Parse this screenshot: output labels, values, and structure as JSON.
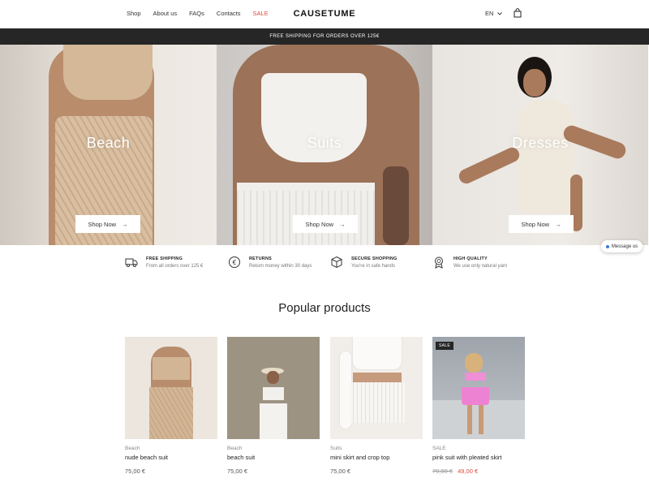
{
  "header": {
    "nav": [
      {
        "label": "Shop"
      },
      {
        "label": "About us"
      },
      {
        "label": "FAQs"
      },
      {
        "label": "Contacts"
      },
      {
        "label": "SALE"
      }
    ],
    "logo": "CAUSETUME",
    "language": "EN",
    "cart_icon": "bag-icon"
  },
  "promo": {
    "text": "FREE SHIPPING FOR ORDERS OVER 125€"
  },
  "hero": {
    "panels": [
      {
        "title": "Beach",
        "button": "Shop Now"
      },
      {
        "title": "Suits",
        "button": "Shop Now"
      },
      {
        "title": "Dresses",
        "button": "Shop Now"
      }
    ]
  },
  "chat": {
    "label": "Message us"
  },
  "features": [
    {
      "icon": "truck-icon",
      "title": "FREE SHIPPING",
      "subtitle": "From all orders over 125 €"
    },
    {
      "icon": "euro-coin-icon",
      "title": "RETURNS",
      "subtitle": "Return money within 30 days"
    },
    {
      "icon": "box-icon",
      "title": "SECURE SHOPPING",
      "subtitle": "You're in safe hands"
    },
    {
      "icon": "quality-badge-icon",
      "title": "HIGH QUALITY",
      "subtitle": "We use only natural yarn"
    }
  ],
  "products_section": {
    "title": "Popular products",
    "items": [
      {
        "category": "Beach",
        "name": "nude beach suit",
        "price": "75,00 €"
      },
      {
        "category": "Beach",
        "name": "beach suit",
        "price": "75,00 €"
      },
      {
        "category": "Suits",
        "name": "mini skirt and crop top",
        "price": "75,00 €"
      },
      {
        "category": "SALE",
        "name": "pink suit with pleated skirt",
        "old_price": "70,00 €",
        "price": "49,00 €",
        "badge": "SALE"
      }
    ]
  },
  "colors": {
    "accent": "#e0483c",
    "dark": "#262626"
  }
}
